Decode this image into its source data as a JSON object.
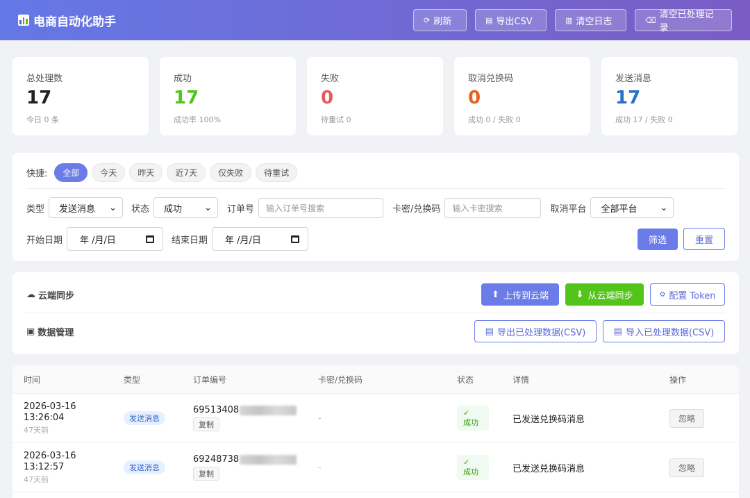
{
  "header": {
    "title": "电商自动化助手",
    "buttons": {
      "refresh": "刷新",
      "export_csv": "导出CSV",
      "clear_log": "清空日志",
      "clear_processed": "清空已处理记录"
    }
  },
  "stats": [
    {
      "label": "总处理数",
      "value": "17",
      "sub": "今日 0 条",
      "color": "#222222"
    },
    {
      "label": "成功",
      "value": "17",
      "sub": "成功率 100%",
      "color": "#52c41a"
    },
    {
      "label": "失败",
      "value": "0",
      "sub": "待重试 0",
      "color": "#e85a5a"
    },
    {
      "label": "取消兑换码",
      "value": "0",
      "sub": "成功 0 / 失败 0",
      "color": "#e8621c"
    },
    {
      "label": "发送消息",
      "value": "17",
      "sub": "成功 17 / 失败 0",
      "color": "#2a6fc9"
    }
  ],
  "filters": {
    "quick_label": "快捷:",
    "quick": [
      "全部",
      "今天",
      "昨天",
      "近7天",
      "仅失败",
      "待重试"
    ],
    "type_label": "类型",
    "type_value": "发送消息",
    "status_label": "状态",
    "status_value": "成功",
    "order_label": "订单号",
    "order_placeholder": "输入订单号搜索",
    "card_label": "卡密/兑换码",
    "card_placeholder": "输入卡密搜索",
    "platform_label": "取消平台",
    "platform_value": "全部平台",
    "start_label": "开始日期",
    "end_label": "结束日期",
    "date_placeholder": "年 /月/日",
    "filter_button": "筛选",
    "reset_button": "重置"
  },
  "cloud": {
    "title": "云端同步",
    "upload": "上传到云端",
    "download": "从云端同步",
    "config": "配置 Token"
  },
  "data_mgmt": {
    "title": "数据管理",
    "export": "导出已处理数据(CSV)",
    "import": "导入已处理数据(CSV)"
  },
  "table": {
    "headers": [
      "时间",
      "类型",
      "订单编号",
      "卡密/兑换码",
      "状态",
      "详情",
      "操作"
    ],
    "rows": [
      {
        "date": "2026-03-16",
        "time": "13:26:04",
        "ago": "47天前",
        "type": "发送消息",
        "order": "69513408",
        "copy": "复制",
        "card": "-",
        "status_icon": "✓",
        "status": "成功",
        "detail": "已发送兑换码消息",
        "action": "忽略"
      },
      {
        "date": "2026-03-16",
        "time": "13:12:57",
        "ago": "47天前",
        "type": "发送消息",
        "order": "69248738",
        "copy": "复制",
        "card": "-",
        "status_icon": "✓",
        "status": "成功",
        "detail": "已发送兑换码消息",
        "action": "忽略"
      }
    ]
  }
}
